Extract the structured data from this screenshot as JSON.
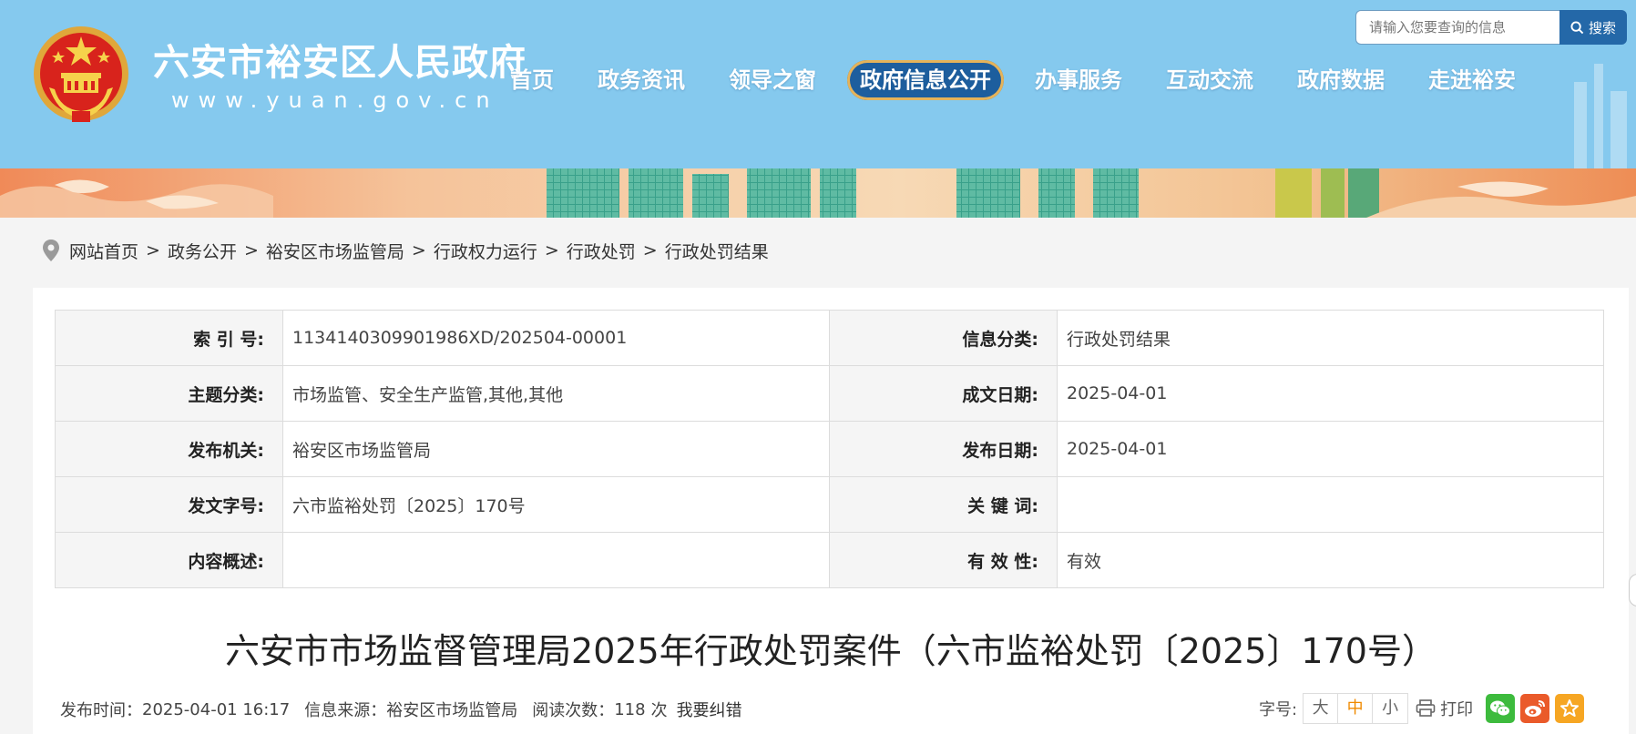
{
  "header": {
    "site_name": "六安市裕安区人民政府",
    "site_url": "www.yuan.gov.cn",
    "search": {
      "placeholder": "请输入您要查询的信息",
      "button_label": "搜索"
    },
    "nav": [
      {
        "label": "首页",
        "active": false
      },
      {
        "label": "政务资讯",
        "active": false
      },
      {
        "label": "领导之窗",
        "active": false
      },
      {
        "label": "政府信息公开",
        "active": true
      },
      {
        "label": "办事服务",
        "active": false
      },
      {
        "label": "互动交流",
        "active": false
      },
      {
        "label": "政府数据",
        "active": false
      },
      {
        "label": "走进裕安",
        "active": false
      }
    ]
  },
  "breadcrumb": [
    "网站首页",
    "政务公开",
    "裕安区市场监管局",
    "行政权力运行",
    "行政处罚",
    "行政处罚结果"
  ],
  "breadcrumb_separator": ">",
  "info_table": [
    {
      "l1": "索 引 号:",
      "v1": "113414030990198​6XD/202504-00001",
      "l2": "信息分类:",
      "v2": "行政处罚结果"
    },
    {
      "l1": "主题分类:",
      "v1": "市场监管、安全生产监管,其他,其他",
      "l2": "成文日期:",
      "v2": "2025-04-01"
    },
    {
      "l1": "发布机关:",
      "v1": "裕安区市场监管局",
      "l2": "发布日期:",
      "v2": "2025-04-01"
    },
    {
      "l1": "发文字号:",
      "v1": "六市监裕处罚〔2025〕170号",
      "l2": "关 键 词:",
      "v2": ""
    },
    {
      "l1": "内容概述:",
      "v1": "",
      "l2": "有 效 性:",
      "v2": "有效"
    }
  ],
  "article": {
    "title": "六安市市场监督管理局2025年行政处罚案件（六市监裕处罚〔2025〕170号）",
    "publish_label": "发布时间：",
    "publish_time": "2025-04-01 16:17",
    "source_label": "信息来源：",
    "source": "裕安区市场监管局",
    "views_label": "阅读次数：",
    "views": "118",
    "views_unit": "次",
    "correction": "我要纠错"
  },
  "tools": {
    "font_label": "字号:",
    "font_sizes": [
      "大",
      "中",
      "小"
    ],
    "current_font_size": "中",
    "print_label": "打印",
    "share_icons": [
      "wechat-icon",
      "weibo-icon",
      "favorite-icon"
    ]
  },
  "colors": {
    "header_bg": "#85c9ee",
    "nav_active_bg": "#1d5e9e",
    "search_button": "#2468a8",
    "active_font_size": "#f08a00"
  }
}
